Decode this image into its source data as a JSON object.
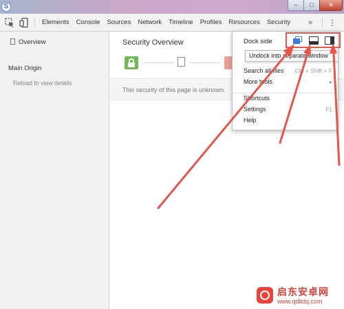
{
  "window": {
    "icon_letter": "S",
    "controls": {
      "minimize": "–",
      "maximize": "□",
      "close": "✕"
    }
  },
  "toolbar": {
    "inspect_icon": "inspect-element-icon",
    "device_icon": "device-mode-icon",
    "tabs": [
      {
        "label": "Elements"
      },
      {
        "label": "Console"
      },
      {
        "label": "Sources"
      },
      {
        "label": "Network"
      },
      {
        "label": "Timeline"
      },
      {
        "label": "Profiles"
      },
      {
        "label": "Resources"
      },
      {
        "label": "Security"
      }
    ],
    "overflow_label": "»",
    "menu_label": "⋮"
  },
  "sidebar": {
    "overview_label": "Overview",
    "main_origin_label": "Main Origin",
    "reload_label": "Reload to view details"
  },
  "main": {
    "title": "Security Overview",
    "summary_text": "This security of this page is unknown."
  },
  "menu": {
    "dock_side_label": "Dock side",
    "dock_buttons": [
      "undock-icon",
      "dock-bottom-icon",
      "dock-right-icon"
    ],
    "tooltip": "Undock into separate window",
    "items": [
      {
        "label": "Search all files",
        "shortcut": "Ctrl + Shift + F"
      },
      {
        "label": "More tools",
        "shortcut": "▸"
      },
      {
        "label": "Shortcuts",
        "shortcut": ""
      },
      {
        "label": "Settings",
        "shortcut": "F1"
      },
      {
        "label": "Help",
        "shortcut": ""
      }
    ]
  },
  "watermark": {
    "title": "启东安卓网",
    "url": "www.qdltdq.com"
  },
  "colors": {
    "highlight": "#e8544a",
    "accent_blue": "#3b7bd8",
    "secure_green": "#74b855"
  }
}
